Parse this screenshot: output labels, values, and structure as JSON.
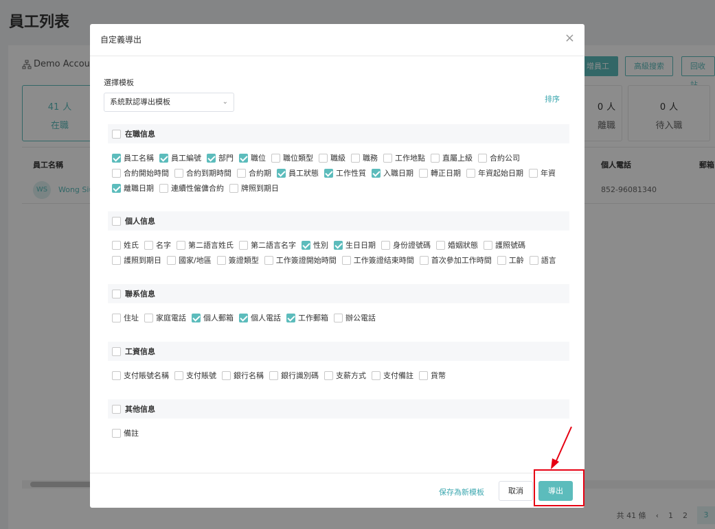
{
  "page": {
    "title": "員工列表",
    "account": "Demo Accou",
    "buttons": {
      "add": "增員工",
      "advanced": "高級搜索",
      "bin": "回收站"
    },
    "stats": [
      {
        "num": "41",
        "unit": "人",
        "label": "在職"
      },
      {
        "num": "0",
        "unit": "人",
        "label": "離職"
      },
      {
        "num": "0",
        "unit": "人",
        "label": "待入職"
      }
    ],
    "table": {
      "col_name": "員工名稱",
      "col_phone": "個人電話",
      "col_email": "郵箱",
      "row": {
        "avatar": "WS",
        "name": "Wong Siu",
        "phone": "852-96081340"
      }
    },
    "pager": {
      "total": "共 41 條",
      "pages": [
        "1",
        "2",
        "3"
      ],
      "current": "3"
    }
  },
  "modal": {
    "title": "自定義導出",
    "close": "×",
    "template_label": "選擇模板",
    "template_value": "系統默認導出模板",
    "sort": "排序",
    "sections": [
      {
        "title": "在職信息",
        "checked": false,
        "items": [
          {
            "label": "員工名稱",
            "checked": true
          },
          {
            "label": "員工編號",
            "checked": true
          },
          {
            "label": "部門",
            "checked": true
          },
          {
            "label": "職位",
            "checked": true
          },
          {
            "label": "職位類型",
            "checked": false
          },
          {
            "label": "職級",
            "checked": false
          },
          {
            "label": "職務",
            "checked": false
          },
          {
            "label": "工作地點",
            "checked": false
          },
          {
            "label": "直屬上級",
            "checked": false
          },
          {
            "label": "合約公司",
            "checked": false
          },
          {
            "label": "合約開始時間",
            "checked": false
          },
          {
            "label": "合約到期時間",
            "checked": false
          },
          {
            "label": "合約期",
            "checked": false
          },
          {
            "label": "員工狀態",
            "checked": true
          },
          {
            "label": "工作性質",
            "checked": true
          },
          {
            "label": "入職日期",
            "checked": true
          },
          {
            "label": "轉正日期",
            "checked": false
          },
          {
            "label": "年資起始日期",
            "checked": false
          },
          {
            "label": "年資",
            "checked": false
          },
          {
            "label": "離職日期",
            "checked": true
          },
          {
            "label": "連續性僱傭合約",
            "checked": false
          },
          {
            "label": "牌照到期日",
            "checked": false
          }
        ]
      },
      {
        "title": "個人信息",
        "checked": false,
        "items": [
          {
            "label": "姓氏",
            "checked": false
          },
          {
            "label": "名字",
            "checked": false
          },
          {
            "label": "第二語言姓氏",
            "checked": false
          },
          {
            "label": "第二語言名字",
            "checked": false
          },
          {
            "label": "性別",
            "checked": true
          },
          {
            "label": "生日日期",
            "checked": true
          },
          {
            "label": "身份證號碼",
            "checked": false
          },
          {
            "label": "婚姻狀態",
            "checked": false
          },
          {
            "label": "護照號碼",
            "checked": false
          },
          {
            "label": "護照到期日",
            "checked": false
          },
          {
            "label": "國家/地區",
            "checked": false
          },
          {
            "label": "簽證類型",
            "checked": false
          },
          {
            "label": "工作簽證開始時間",
            "checked": false
          },
          {
            "label": "工作簽證结束時間",
            "checked": false
          },
          {
            "label": "首次參加工作時間",
            "checked": false
          },
          {
            "label": "工齡",
            "checked": false
          },
          {
            "label": "語言",
            "checked": false
          }
        ]
      },
      {
        "title": "聯系信息",
        "checked": false,
        "items": [
          {
            "label": "住址",
            "checked": false
          },
          {
            "label": "家庭電話",
            "checked": false
          },
          {
            "label": "個人郵箱",
            "checked": true
          },
          {
            "label": "個人電話",
            "checked": true
          },
          {
            "label": "工作郵箱",
            "checked": true
          },
          {
            "label": "辦公電話",
            "checked": false
          }
        ]
      },
      {
        "title": "工資信息",
        "checked": false,
        "items": [
          {
            "label": "支付賬號名稱",
            "checked": false
          },
          {
            "label": "支付賬號",
            "checked": false
          },
          {
            "label": "銀行名稱",
            "checked": false
          },
          {
            "label": "銀行識別碼",
            "checked": false
          },
          {
            "label": "支薪方式",
            "checked": false
          },
          {
            "label": "支付備註",
            "checked": false
          },
          {
            "label": "貨幣",
            "checked": false
          }
        ]
      },
      {
        "title": "其他信息",
        "checked": false,
        "items": [
          {
            "label": "備註",
            "checked": false
          }
        ]
      }
    ],
    "footer": {
      "save_template": "保存為新模板",
      "cancel": "取消",
      "export": "導出"
    }
  },
  "colors": {
    "accent": "#5cbcbc",
    "annotation": "#e60012"
  }
}
